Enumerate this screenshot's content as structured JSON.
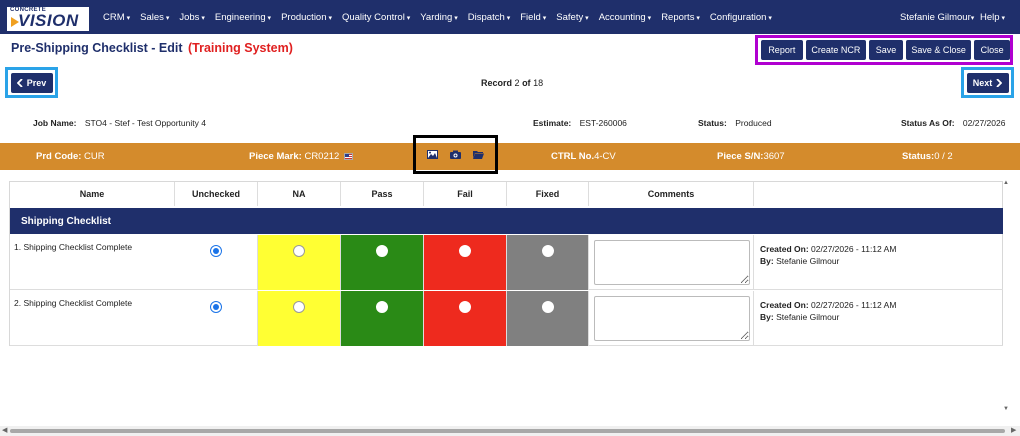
{
  "app": {
    "logo_small": "CONCRETE",
    "logo_big": "VISION"
  },
  "nav": {
    "items": [
      "CRM",
      "Sales",
      "Jobs",
      "Engineering",
      "Production",
      "Quality Control",
      "Yarding",
      "Dispatch",
      "Field",
      "Safety",
      "Accounting",
      "Reports",
      "Configuration"
    ],
    "user": "Stefanie Gilmour",
    "help": "Help"
  },
  "page": {
    "title": "Pre-Shipping Checklist - Edit",
    "training_tag": "(Training System)"
  },
  "actions": {
    "report": "Report",
    "create_ncr": "Create NCR",
    "save": "Save",
    "save_close": "Save & Close",
    "close": "Close"
  },
  "pager": {
    "prev": "Prev",
    "next": "Next",
    "record_label": "Record",
    "current": "2",
    "of_label": "of",
    "total": "18"
  },
  "info": {
    "job_label": "Job Name:",
    "job_value": "STO4 - Stef - Test Opportunity 4",
    "estimate_label": "Estimate:",
    "estimate_value": "EST-260006",
    "status_label": "Status:",
    "status_value": "Produced",
    "status_as_of_label": "Status As Of:",
    "status_as_of_value": "02/27/2026"
  },
  "piece": {
    "prd_code_label": "Prd Code:",
    "prd_code_value": "CUR",
    "piece_mark_label": "Piece Mark:",
    "piece_mark_value": "CR0212",
    "ctrl_label": "CTRL No.",
    "ctrl_value": "4-CV",
    "sn_label": "Piece S/N:",
    "sn_value": "3607",
    "status_label": "Status:",
    "status_value": "0 / 2"
  },
  "table": {
    "headers": [
      "Name",
      "Unchecked",
      "NA",
      "Pass",
      "Fail",
      "Fixed",
      "Comments"
    ],
    "section_title": "Shipping Checklist",
    "rows": [
      {
        "name": "1. Shipping Checklist Complete",
        "selected": "Unchecked",
        "comment": "",
        "created_on_label": "Created On:",
        "created_on_value": "02/27/2026 - 11:12 AM",
        "by_label": "By:",
        "by_value": "Stefanie Gilmour"
      },
      {
        "name": "2. Shipping Checklist Complete",
        "selected": "Unchecked",
        "comment": "",
        "created_on_label": "Created On:",
        "created_on_value": "02/27/2026 - 11:12 AM",
        "by_label": "By:",
        "by_value": "Stefanie Gilmour"
      }
    ]
  },
  "colors": {
    "navy": "#1f2f6b",
    "orange": "#d48b2c",
    "na_yellow": "#ffff33",
    "pass_green": "#2a8a16",
    "fail_red": "#ee2a1e",
    "fixed_gray": "#808080",
    "training_red": "#e02020"
  },
  "icons": [
    "image-icon",
    "camera-icon",
    "folder-open-icon",
    "flag-icon"
  ]
}
